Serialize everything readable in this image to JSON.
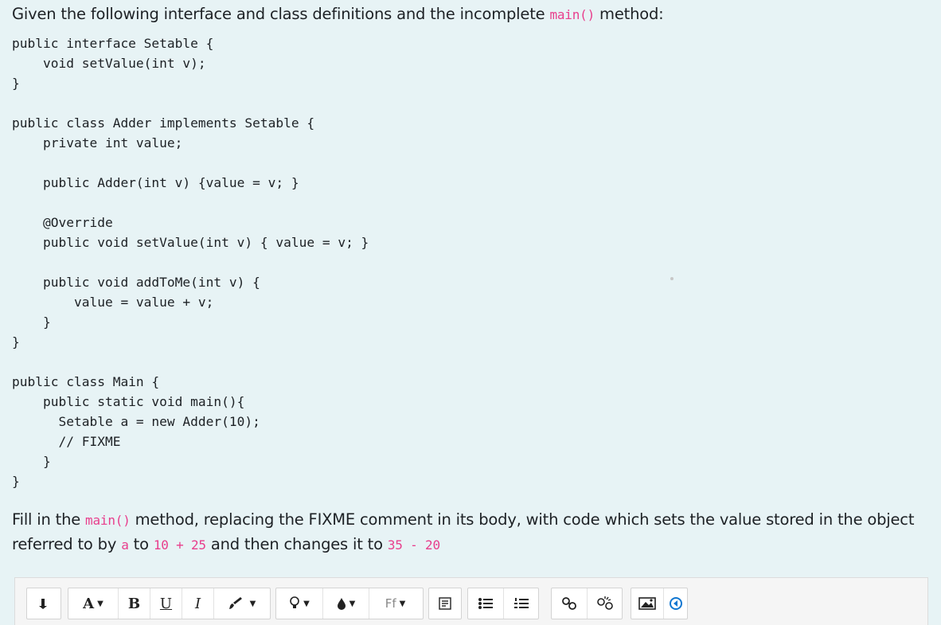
{
  "intro": {
    "text_before": "Given the following interface and class definitions and the incomplete ",
    "code": "main()",
    "text_after": " method:"
  },
  "code_block": "public interface Setable {\n    void setValue(int v);\n}\n\npublic class Adder implements Setable {\n    private int value;\n\n    public Adder(int v) {value = v; }\n\n    @Override\n    public void setValue(int v) { value = v; }\n\n    public void addToMe(int v) {\n        value = value + v;\n    }\n}\n\npublic class Main {\n    public static void main(){\n      Setable a = new Adder(10);\n      // FIXME\n    }\n}",
  "instruction": {
    "t1": "Fill in the ",
    "c1": "main()",
    "t2": " method, replacing the FIXME comment in its body, with code which sets the value stored in the object referred to by ",
    "c2": "a",
    "t3": " to ",
    "c3": "10 + 25",
    "t4": " and then changes it to ",
    "c4": "35 - 20"
  },
  "toolbar": {
    "collapse_icon": "arrow-down-icon",
    "font_size_label": "A",
    "bold_label": "B",
    "underline_label": "U",
    "italic_label": "I",
    "font_family_label": "Ff",
    "accent_color": "#e83e8c",
    "atto_blue": "#1177d1"
  }
}
